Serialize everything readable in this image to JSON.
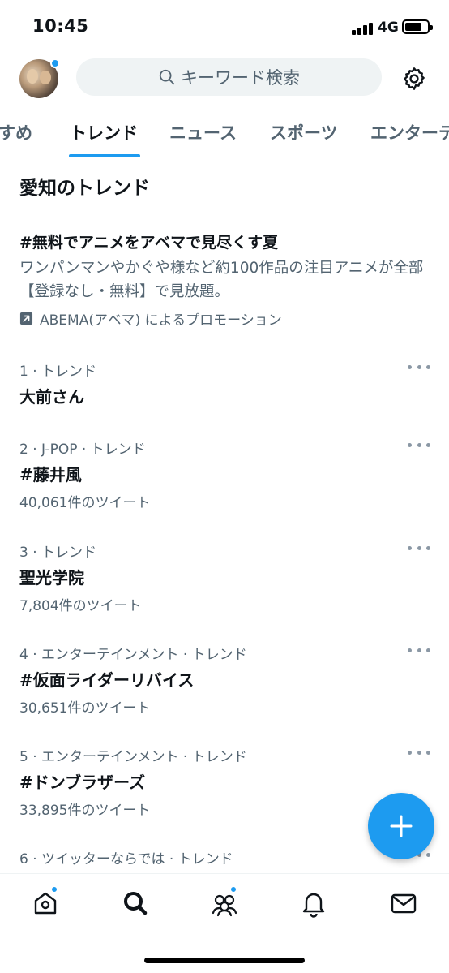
{
  "status_bar": {
    "time": "10:45",
    "network": "4G"
  },
  "header": {
    "search_placeholder": "キーワード検索",
    "search_icon": "search-icon",
    "settings_icon": "gear-icon"
  },
  "tabs": [
    {
      "label": "すめ",
      "active": false
    },
    {
      "label": "トレンド",
      "active": true
    },
    {
      "label": "ニュース",
      "active": false
    },
    {
      "label": "スポーツ",
      "active": false
    },
    {
      "label": "エンターテ",
      "active": false
    }
  ],
  "section_title": "愛知のトレンド",
  "promoted": {
    "title": "#無料でアニメをアベマで見尽くす夏",
    "description": "ワンパンマンやかぐや様など約100作品の注目アニメが全部【登録なし・無料】で見放題。",
    "promoted_by": "ABEMA(アベマ) によるプロモーション"
  },
  "trends": [
    {
      "meta": "1 · トレンド",
      "name": "大前さん",
      "count": ""
    },
    {
      "meta": "2 · J-POP · トレンド",
      "name": "#藤井風",
      "count": "40,061件のツイート"
    },
    {
      "meta": "3 · トレンド",
      "name": "聖光学院",
      "count": "7,804件のツイート"
    },
    {
      "meta": "4 · エンターテインメント · トレンド",
      "name": "#仮面ライダーリバイス",
      "count": "30,651件のツイート"
    },
    {
      "meta": "5 · エンターテインメント · トレンド",
      "name": "#ドンブラザーズ",
      "count": "33,895件のツイート"
    },
    {
      "meta": "6 · ツイッターならでは · トレンド",
      "name": "",
      "count": ""
    }
  ],
  "bottom_nav": [
    {
      "icon": "home-icon",
      "badge": true
    },
    {
      "icon": "search-icon",
      "badge": false,
      "active": true
    },
    {
      "icon": "communities-icon",
      "badge": true
    },
    {
      "icon": "notifications-icon",
      "badge": false
    },
    {
      "icon": "messages-icon",
      "badge": false
    }
  ],
  "colors": {
    "accent": "#1d9bf0",
    "text": "#0f1419",
    "secondary_text": "#536471"
  }
}
